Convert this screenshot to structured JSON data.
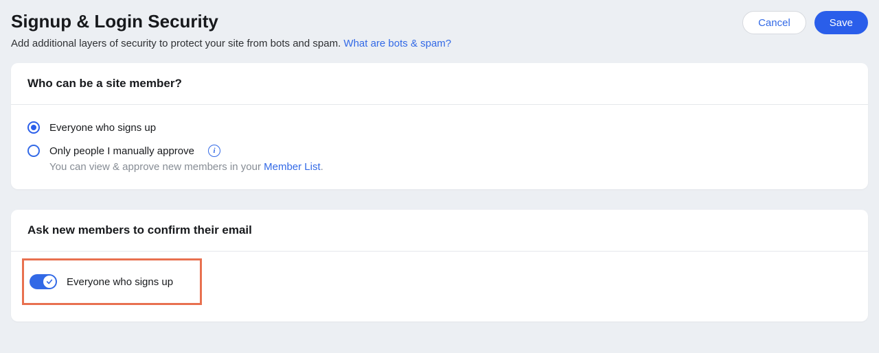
{
  "header": {
    "title": "Signup & Login Security",
    "subtitle": "Add additional layers of security to protect your site from bots and spam. ",
    "subtitle_link": "What are bots & spam?",
    "cancel_label": "Cancel",
    "save_label": "Save"
  },
  "card1": {
    "title": "Who can be a site member?",
    "option1_label": "Everyone who signs up",
    "option2_label": "Only people I manually approve",
    "hint_prefix": "You can view & approve new members in your ",
    "hint_link": "Member List",
    "hint_suffix": "."
  },
  "card2": {
    "title": "Ask new members to confirm their email",
    "toggle_label": "Everyone who signs up",
    "toggle_on": true
  }
}
